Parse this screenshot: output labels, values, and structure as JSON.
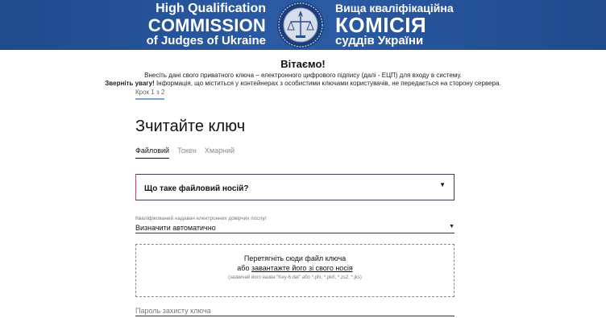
{
  "header": {
    "en_line1": "High Qualification",
    "en_line2": "COMMISSION",
    "en_line3": "of Judges of Ukraine",
    "ua_line1": "Вища кваліфікаційна",
    "ua_line2": "КОМІСІЯ",
    "ua_line3": "суддів України",
    "banner_color": "#2a5aa2"
  },
  "welcome": {
    "title": "Вітаємо!",
    "line1": "Внесіть дані свого приватного ключа – електронного цифрового підпису (далі - ЕЦП) для входу в систему.",
    "line2_bold": "Зверніть увагу!",
    "line2_rest": " Інформація, що міститься у контейнерах з особистими ключами користувачів, не передається на сторону сервера."
  },
  "step": "Крок 1 з 2",
  "page_title": "Зчитайте ключ",
  "tabs": [
    {
      "label": "Файловий",
      "active": true
    },
    {
      "label": "Токен",
      "active": false
    },
    {
      "label": "Хмарний",
      "active": false
    }
  ],
  "accordion": {
    "label": "Що таке файловий носій?",
    "icon": "caret-down-icon"
  },
  "provider": {
    "label": "Кваліфікований надавач електронних довірчих послуг",
    "value": "Визначити автоматично"
  },
  "dropzone": {
    "line1": "Перетягніть сюди файл ключа",
    "line2_prefix": "або ",
    "line2_link": "завантажте його зі свого носія",
    "hint": "(зазвичай його назва \"Key-6.dat\" або *.pfx, *.pk8, *.zs2, *.jks)"
  },
  "password": {
    "placeholder": "Пароль захисту ключа"
  }
}
